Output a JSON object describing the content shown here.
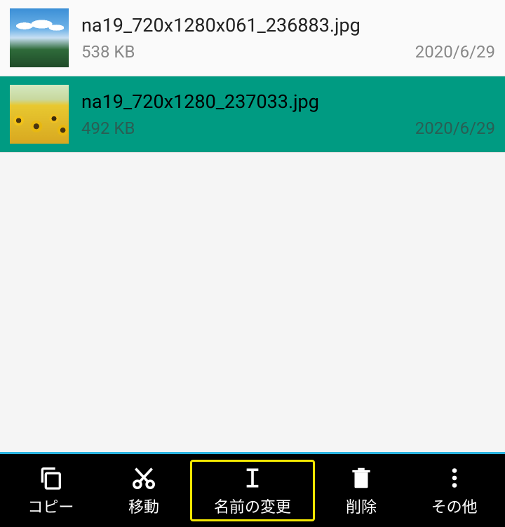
{
  "files": [
    {
      "name": "na19_720x1280x061_236883.jpg",
      "size": "538 KB",
      "date": "2020/6/29",
      "selected": false,
      "thumb": "sky"
    },
    {
      "name": "na19_720x1280_237033.jpg",
      "size": "492 KB",
      "date": "2020/6/29",
      "selected": true,
      "thumb": "sunflowers"
    }
  ],
  "toolbar": {
    "copy": "コピー",
    "move": "移動",
    "rename": "名前の変更",
    "delete": "削除",
    "more": "その他"
  },
  "highlighted_action": "rename"
}
